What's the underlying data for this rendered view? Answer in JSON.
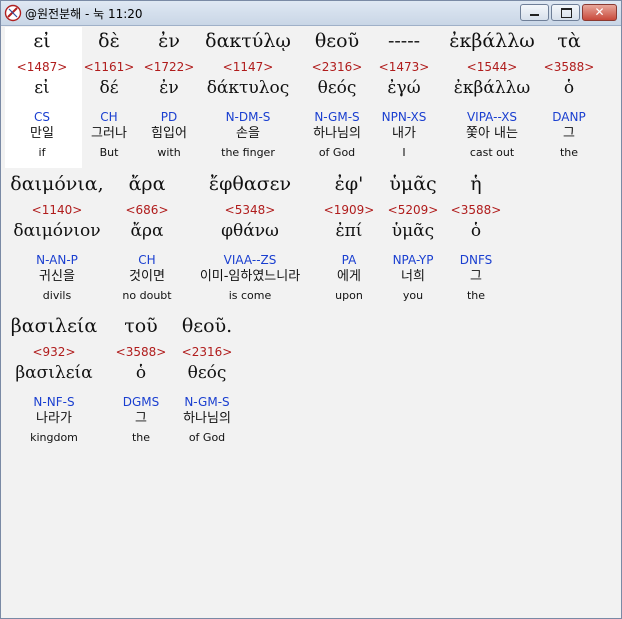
{
  "window": {
    "title": "@원전분해 - 눅 11:20",
    "minimize_glyph": "",
    "close_glyph": "✕"
  },
  "lines": [
    {
      "words": [
        {
          "greek": "εἰ",
          "strong": "<1487>",
          "lemma": "εἰ",
          "morph": "CS",
          "korean": "만일",
          "english": "if"
        },
        {
          "greek": "δὲ",
          "strong": "<1161>",
          "lemma": "δέ",
          "morph": "CH",
          "korean": "그러나",
          "english": "But"
        },
        {
          "greek": "ἐν",
          "strong": "<1722>",
          "lemma": "ἐν",
          "morph": "PD",
          "korean": "힘입어",
          "english": "with"
        },
        {
          "greek": "δακτύλῳ",
          "strong": "<1147>",
          "lemma": "δάκτυλος",
          "morph": "N-DM-S",
          "korean": "손을",
          "english": "the finger"
        },
        {
          "greek": "θεοῦ",
          "strong": "<2316>",
          "lemma": "θεός",
          "morph": "N-GM-S",
          "korean": "하나님의",
          "english": "of God"
        },
        {
          "greek": "-----",
          "strong": "<1473>",
          "lemma": "ἐγώ",
          "morph": "NPN-XS",
          "korean": "내가",
          "english": "I"
        },
        {
          "greek": "ἐκβάλλω",
          "strong": "<1544>",
          "lemma": "ἐκβάλλω",
          "morph": "VIPA--XS",
          "korean": "쫓아 내는",
          "english": "cast out"
        },
        {
          "greek": "τὰ",
          "strong": "<3588>",
          "lemma": "ὁ",
          "morph": "DANP",
          "korean": "그",
          "english": "the"
        }
      ]
    },
    {
      "words": [
        {
          "greek": "δαιμόνια,",
          "strong": "<1140>",
          "lemma": "δαιμόνιον",
          "morph": "N-AN-P",
          "korean": "귀신을",
          "english": "divils"
        },
        {
          "greek": "ἄρα",
          "strong": "<686>",
          "lemma": "ἄρα",
          "morph": "CH",
          "korean": "것이면",
          "english": "no doubt"
        },
        {
          "greek": "ἔφθασεν",
          "strong": "<5348>",
          "lemma": "φθάνω",
          "morph": "VIAA--ZS",
          "korean": "이미-임하였느니라",
          "english": "is come"
        },
        {
          "greek": "ἐφ'",
          "strong": "<1909>",
          "lemma": "ἐπί",
          "morph": "PA",
          "korean": "에게",
          "english": "upon"
        },
        {
          "greek": "ὑμᾶς",
          "strong": "<5209>",
          "lemma": "ὑμᾶς",
          "morph": "NPA-YP",
          "korean": "너희",
          "english": "you"
        },
        {
          "greek": "ἡ",
          "strong": "<3588>",
          "lemma": "ὁ",
          "morph": "DNFS",
          "korean": "그",
          "english": "the"
        }
      ]
    },
    {
      "words": [
        {
          "greek": "βασιλεία",
          "strong": "<932>",
          "lemma": "βασιλεία",
          "morph": "N-NF-S",
          "korean": "나라가",
          "english": "kingdom"
        },
        {
          "greek": "τοῦ",
          "strong": "<3588>",
          "lemma": "ὁ",
          "morph": "DGMS",
          "korean": "그",
          "english": "the"
        },
        {
          "greek": "θεοῦ.",
          "strong": "<2316>",
          "lemma": "θεός",
          "morph": "N-GM-S",
          "korean": "하나님의",
          "english": "of God"
        }
      ]
    }
  ]
}
